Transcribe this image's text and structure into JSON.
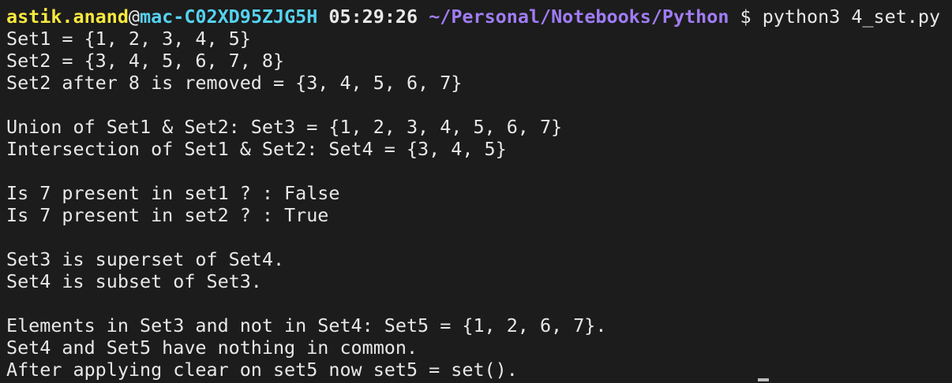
{
  "prompt": {
    "user": "astik.anand",
    "at": "@",
    "host": "mac-C02XD95ZJG5H",
    "time": "05:29:26",
    "path": "~/Personal/Notebooks/Python",
    "symbol": "$",
    "command": "python3 4_set.py"
  },
  "output": {
    "line1": "Set1 = {1, 2, 3, 4, 5}",
    "line2": "Set2 = {3, 4, 5, 6, 7, 8}",
    "line3": "Set2 after 8 is removed = {3, 4, 5, 6, 7}",
    "line5": "Union of Set1 & Set2: Set3 = {1, 2, 3, 4, 5, 6, 7}",
    "line6": "Intersection of Set1 & Set2: Set4 = {3, 4, 5}",
    "line8": "Is 7 present in set1 ? : False",
    "line9": "Is 7 present in set2 ? : True",
    "line11": "Set3 is superset of Set4.",
    "line12": "Set4 is subset of Set3.",
    "line14": "Elements in Set3 and not in Set4: Set5 = {1, 2, 6, 7}.",
    "line15": "Set4 and Set5 have nothing in common.",
    "line16": "After applying clear on set5 now set5 = set()."
  }
}
